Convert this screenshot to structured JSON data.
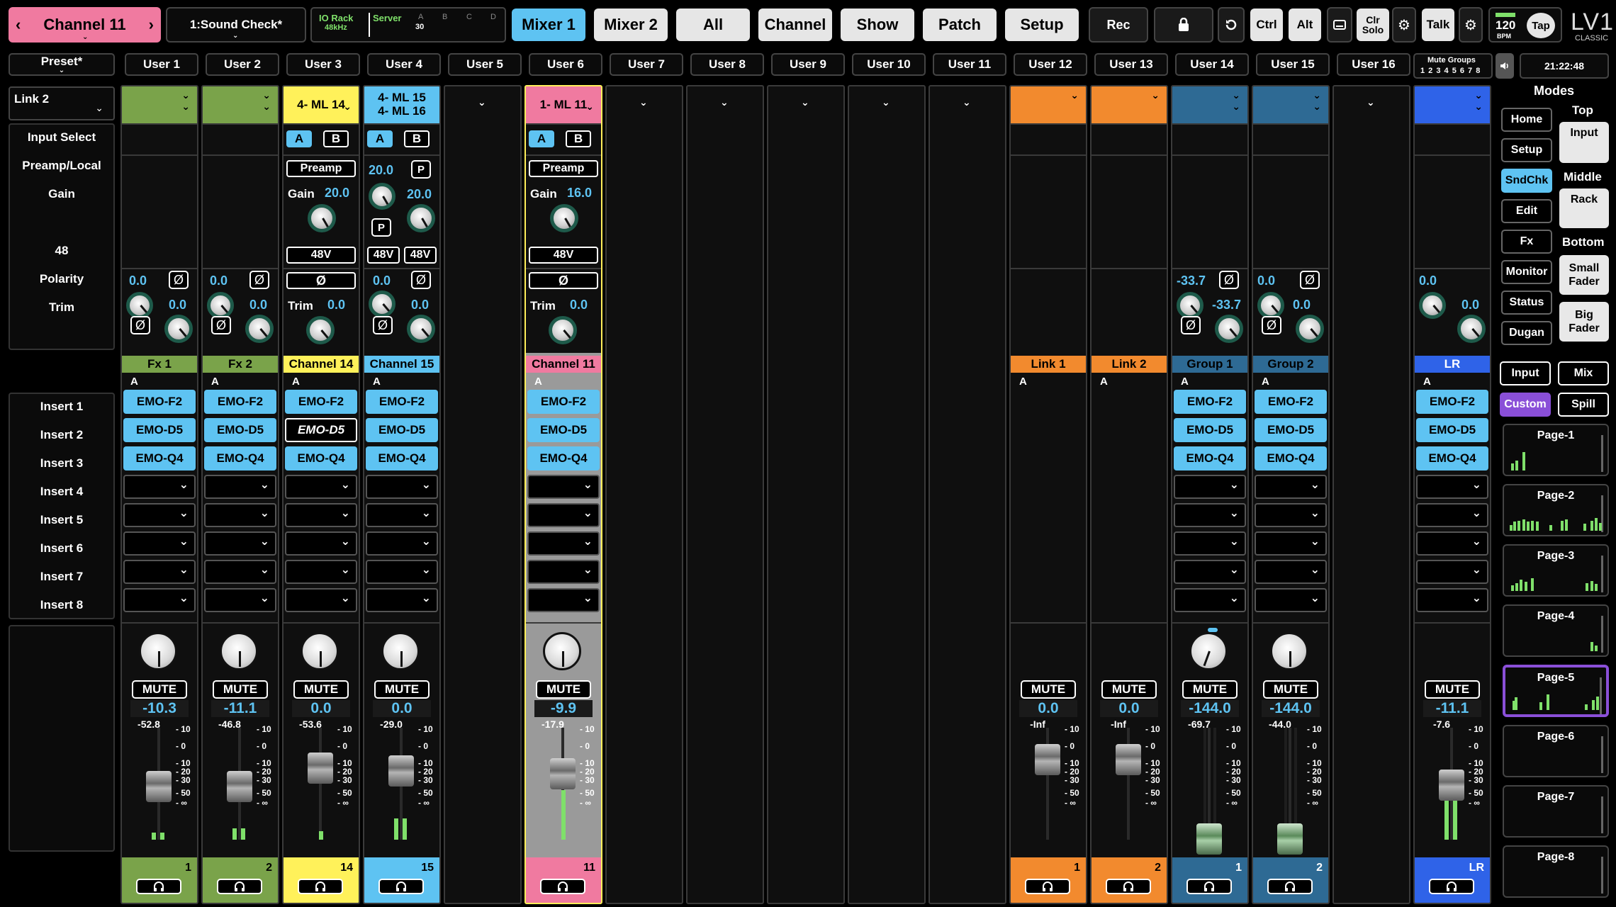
{
  "header": {
    "channel_selector": {
      "prev": "‹",
      "label": "Channel 11",
      "next": "›"
    },
    "preset_selector": "1:Sound Check*",
    "io": {
      "rack": "IO Rack",
      "rate": "48kHz",
      "server": "Server",
      "a": "A",
      "b": "B",
      "c": "C",
      "d": "D",
      "count": "30"
    },
    "nav": [
      "Mixer 1",
      "Mixer 2",
      "All",
      "Channel",
      "Show",
      "Patch",
      "Setup"
    ],
    "rec": "Rec",
    "ctrl": "Ctrl",
    "alt": "Alt",
    "clr_solo": "Clr Solo",
    "talk": "Talk",
    "bpm": "120",
    "bpm_unit": "BPM",
    "tap": "Tap",
    "logo": "LV1",
    "logo_sub": "CLASSIC"
  },
  "user_bar": {
    "preset": "Preset*",
    "users": [
      "User 1",
      "User 2",
      "User 3",
      "User 4",
      "User 5",
      "User 6",
      "User 7",
      "User 8",
      "User 9",
      "User 10",
      "User 11",
      "User 12",
      "User 13",
      "User 14",
      "User 15",
      "User 16"
    ],
    "mute_groups_title": "Mute Groups",
    "mute_groups_nums": "1 2 3 4 5 6 7 8",
    "clock": "21:22:48"
  },
  "left_panel": {
    "link": "Link 2",
    "rows": [
      "Input Select",
      "Preamp/Local",
      "Gain",
      "48",
      "Polarity",
      "Trim"
    ],
    "inserts": [
      "Insert 1",
      "Insert 2",
      "Insert 3",
      "Insert 4",
      "Insert 5",
      "Insert 6",
      "Insert 7",
      "Insert 8"
    ]
  },
  "strips": [
    {
      "id": "fx1",
      "name": "Fx 1",
      "tag": "A",
      "gain1": "0.0",
      "gain2": "0.0",
      "inserts": [
        "EMO-F2",
        "EMO-D5",
        "EMO-Q4"
      ],
      "fader": "-10.3",
      "peak": "-52.8",
      "num": "1",
      "mute": "MUTE"
    },
    {
      "id": "fx2",
      "name": "Fx 2",
      "tag": "A",
      "gain1": "0.0",
      "gain2": "0.0",
      "inserts": [
        "EMO-F2",
        "EMO-D5",
        "EMO-Q4"
      ],
      "fader": "-11.1",
      "peak": "-46.8",
      "num": "2",
      "mute": "MUTE"
    },
    {
      "id": "ch14",
      "head": "4- ML 14",
      "a": "A",
      "b": "B",
      "preamp": "Preamp",
      "gain_label": "Gain",
      "gain": "20.0",
      "v48": "48V",
      "trim_label": "Trim",
      "trim": "0.0",
      "name": "Channel 14",
      "tag": "A",
      "inserts": [
        "EMO-F2",
        "EMO-D5",
        "EMO-Q4"
      ],
      "fader": "0.0",
      "peak": "-53.6",
      "num": "14",
      "mute": "MUTE"
    },
    {
      "id": "ch15",
      "head1": "4- ML 15",
      "head2": "4- ML 16",
      "a": "A",
      "b": "B",
      "g1": "20.0",
      "g2": "20.0",
      "p": "P",
      "v48": "48V",
      "t1": "0.0",
      "t2": "0.0",
      "name": "Channel 15",
      "tag": "A",
      "inserts": [
        "EMO-F2",
        "EMO-D5",
        "EMO-Q4"
      ],
      "fader": "0.0",
      "peak": "-29.0",
      "num": "15",
      "mute": "MUTE"
    },
    {
      "id": "ch11",
      "head": "1- ML 11",
      "a": "A",
      "b": "B",
      "preamp": "Preamp",
      "gain_label": "Gain",
      "gain": "16.0",
      "v48": "48V",
      "trim_label": "Trim",
      "trim": "0.0",
      "name": "Channel 11",
      "tag": "A",
      "inserts": [
        "EMO-F2",
        "EMO-D5",
        "EMO-Q4"
      ],
      "fader": "-9.9",
      "peak": "-17.9",
      "num": "11",
      "mute": "MUTE"
    },
    {
      "id": "link1",
      "name": "Link 1",
      "tag": "A",
      "fader": "0.0",
      "peak": "-Inf",
      "num": "1",
      "mute": "MUTE"
    },
    {
      "id": "link2",
      "name": "Link 2",
      "tag": "A",
      "fader": "0.0",
      "peak": "-Inf",
      "num": "2",
      "mute": "MUTE"
    },
    {
      "id": "grp1",
      "name": "Group 1",
      "tag": "A",
      "v1": "-33.7",
      "v2": "-33.7",
      "inserts": [
        "EMO-F2",
        "EMO-D5",
        "EMO-Q4"
      ],
      "fader": "-144.0",
      "peak": "-69.7",
      "num": "1",
      "mute": "MUTE"
    },
    {
      "id": "grp2",
      "name": "Group 2",
      "tag": "A",
      "v1": "0.0",
      "v2": "0.0",
      "inserts": [
        "EMO-F2",
        "EMO-D5",
        "EMO-Q4"
      ],
      "fader": "-144.0",
      "peak": "-44.0",
      "num": "2",
      "mute": "MUTE"
    },
    {
      "id": "lr",
      "name": "LR",
      "tag": "A",
      "v1": "0.0",
      "v2": "0.0",
      "inserts": [
        "EMO-F2",
        "EMO-D5",
        "EMO-Q4"
      ],
      "fader": "-11.1",
      "peak": "-7.6",
      "num": "LR",
      "mute": "MUTE"
    }
  ],
  "scale": [
    "10",
    "0",
    "10",
    "20",
    "30",
    "50",
    "∞"
  ],
  "right_panel": {
    "modes": "Modes",
    "left_col": [
      "Home",
      "Setup",
      "SndChk",
      "Edit",
      "Fx",
      "Monitor",
      "Status",
      "Dugan"
    ],
    "top": "Top",
    "input": "Input",
    "middle": "Middle",
    "rack": "Rack",
    "bottom": "Bottom",
    "small_fader": "Small Fader",
    "big_fader": "Big Fader",
    "input2": "Input",
    "mix": "Mix",
    "custom": "Custom",
    "spill": "Spill",
    "pages": [
      "Page-1",
      "Page-2",
      "Page-3",
      "Page-4",
      "Page-5",
      "Page-6",
      "Page-7",
      "Page-8"
    ]
  },
  "colors": {
    "green": "#7aa34a",
    "yellow": "#fff15a",
    "blue": "#5ec3f2",
    "pink": "#f07aa0",
    "orange": "#f28a2e",
    "steel": "#2e6a94",
    "lr": "#2f63e8",
    "purple": "#8a4fd8"
  }
}
